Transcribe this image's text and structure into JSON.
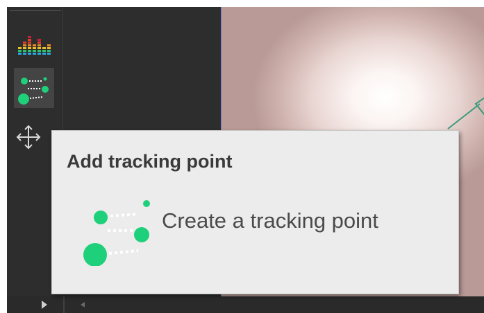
{
  "tooltip": {
    "title": "Add tracking point",
    "description": "Create a tracking point"
  },
  "toolbar": {
    "tools": [
      {
        "icon": "equalizer-icon",
        "selected": false
      },
      {
        "icon": "add-tracking-point-icon",
        "selected": true
      },
      {
        "icon": "move-icon",
        "selected": false
      }
    ]
  },
  "colors": {
    "accent_green": "#1fd07a",
    "panel_bg": "#2d2d2d",
    "tooltip_bg": "#ececec",
    "track_line": "#3a9a7a"
  }
}
